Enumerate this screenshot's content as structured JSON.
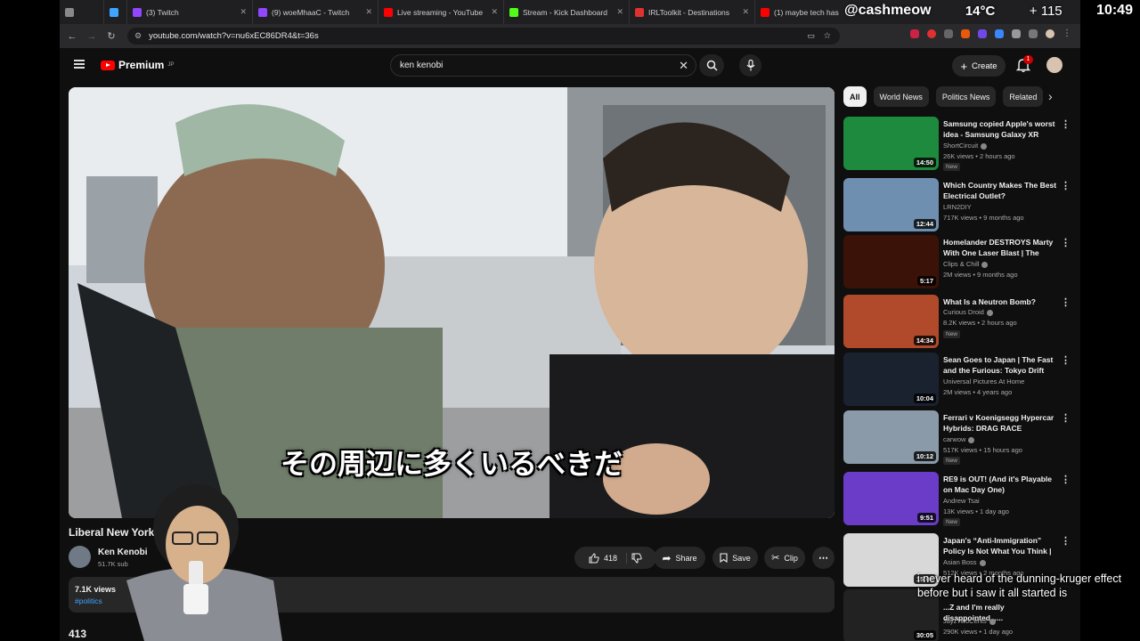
{
  "tabs": [
    {
      "label": "",
      "color": "#888"
    },
    {
      "label": "",
      "color": "#3ea6ff"
    },
    {
      "label": "(3) Twitch",
      "color": "#9146ff"
    },
    {
      "label": "(9) woeMhaaC - Twitch",
      "color": "#9146ff"
    },
    {
      "label": "Live streaming - YouTube",
      "color": "#ff0000"
    },
    {
      "label": "Stream - Kick Dashboard",
      "color": "#53fc18"
    },
    {
      "label": "IRLToolkit - Destinations",
      "color": "#e03131"
    },
    {
      "label": "(1) maybe tech has",
      "color": "#ff0000"
    }
  ],
  "url": "youtube.com/watch?v=nu6xEC86DR4&t=36s",
  "yt": {
    "logo_text": "Premium",
    "logo_sup": "JP",
    "search_value": "ken kenobi",
    "create_label": "Create",
    "notif_count": "1"
  },
  "video": {
    "subtitle": "その周辺に多くいるべきだ",
    "title": "Liberal New York ....full debate",
    "channel": "Ken Kenobi",
    "subs": "51.7K sub",
    "likes": "418",
    "share": "Share",
    "save": "Save",
    "clip": "Clip",
    "views": "7.1K views",
    "tag": "#politics",
    "comments": "413"
  },
  "chips": [
    "All",
    "World News",
    "Politics News",
    "Related"
  ],
  "recs": [
    {
      "title": "Samsung copied Apple's worst idea - Samsung Galaxy XR",
      "channel": "ShortCircuit",
      "meta": "26K views • 2 hours ago",
      "new": "New",
      "dur": "14:50",
      "bg": "#1d8a3d"
    },
    {
      "title": "Which Country Makes The Best Electrical Outlet?",
      "channel": "LRN2DIY",
      "meta": "717K views • 9 months ago",
      "new": "",
      "dur": "12:44",
      "bg": "#6f8fb0"
    },
    {
      "title": "Homelander DESTROYS Marty With One Laser Blast | The Boy...",
      "channel": "Clips & Chill",
      "meta": "2M views • 9 months ago",
      "new": "",
      "dur": "5:17",
      "bg": "#3b1208"
    },
    {
      "title": "What Is a Neutron Bomb?",
      "channel": "Curious Droid",
      "meta": "8.2K views • 2 hours ago",
      "new": "New",
      "dur": "14:34",
      "bg": "#b04a2a"
    },
    {
      "title": "Sean Goes to Japan | The Fast and the Furious: Tokyo Drift",
      "channel": "Universal Pictures At Home",
      "meta": "2M views • 4 years ago",
      "new": "",
      "dur": "10:04",
      "bg": "#1a2230"
    },
    {
      "title": "Ferrari v Koenigsegg Hypercar Hybrids: DRAG RACE",
      "channel": "carwow",
      "meta": "517K views • 15 hours ago",
      "new": "New",
      "dur": "10:12",
      "bg": "#8a9aa8"
    },
    {
      "title": "RE9 is OUT! (And it's Playable on Mac Day One)",
      "channel": "Andrew Tsai",
      "meta": "13K views • 1 day ago",
      "new": "New",
      "dur": "9:51",
      "bg": "#6a3cc8"
    },
    {
      "title": "Japan's “Anti-Immigration” Policy Is Not What You Think | ...",
      "channel": "Asian Boss",
      "meta": "512K views • 2 months ago",
      "new": "",
      "dur": "15:04",
      "bg": "#d8d8d8"
    },
    {
      "title": "...Z and I'm really disappointed......",
      "channel": "JayzTwoCents",
      "meta": "290K views • 1 day ago",
      "new": "",
      "dur": "30:05",
      "bg": "#222"
    }
  ],
  "overlay": {
    "handle": "@cashmeow",
    "temp": "14°C",
    "count": "+ 115",
    "clock": "10:49",
    "chat": "i never heard of the dunning-kruger effect before but i saw it all started is"
  }
}
